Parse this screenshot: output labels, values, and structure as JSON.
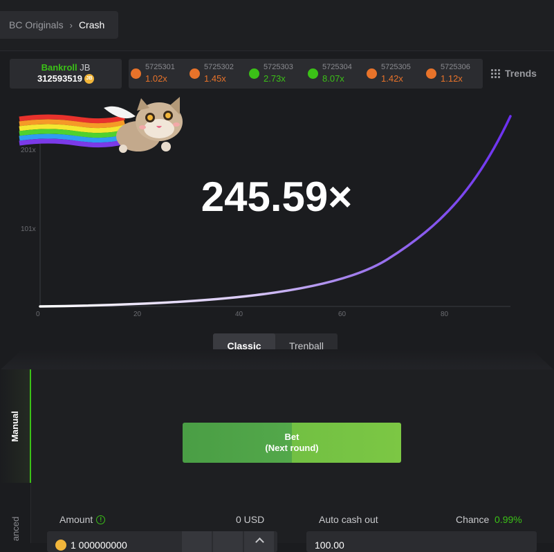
{
  "breadcrumb": {
    "parent": "BC Originals",
    "current": "Crash"
  },
  "bankroll": {
    "label": "Bankroll",
    "currency": "JB",
    "value": "312593519",
    "coin_glyph": "JB"
  },
  "history": [
    {
      "id": "5725301",
      "multiplier": "1.02x",
      "color": "#e8732a"
    },
    {
      "id": "5725302",
      "multiplier": "1.45x",
      "color": "#e8732a"
    },
    {
      "id": "5725303",
      "multiplier": "2.73x",
      "color": "#3bc117"
    },
    {
      "id": "5725304",
      "multiplier": "8.07x",
      "color": "#3bc117"
    },
    {
      "id": "5725305",
      "multiplier": "1.42x",
      "color": "#e8732a"
    },
    {
      "id": "5725306",
      "multiplier": "1.12x",
      "color": "#e8732a"
    }
  ],
  "trends_label": "Trends",
  "game": {
    "multiplier": "245.59×",
    "y_ticks": [
      "201x",
      "101x"
    ],
    "x_ticks": [
      "0",
      "20",
      "40",
      "60",
      "80"
    ],
    "curve_color": "#6b2ff0"
  },
  "modes": {
    "classic": "Classic",
    "trenball": "Trenball",
    "active": "classic"
  },
  "side_tabs": {
    "manual": "Manual",
    "advanced": "anced"
  },
  "bet_button": {
    "line1": "Bet",
    "line2": "(Next round)"
  },
  "amount": {
    "label": "Amount",
    "usd": "0 USD",
    "value": "1 000000000"
  },
  "auto_cash_out": {
    "label": "Auto cash out",
    "value": "100.00"
  },
  "chance": {
    "label": "Chance",
    "value": "0.99%"
  },
  "colors": {
    "accent_green": "#3bc117",
    "loss_orange": "#e8732a",
    "bg": "#1b1c1f"
  }
}
